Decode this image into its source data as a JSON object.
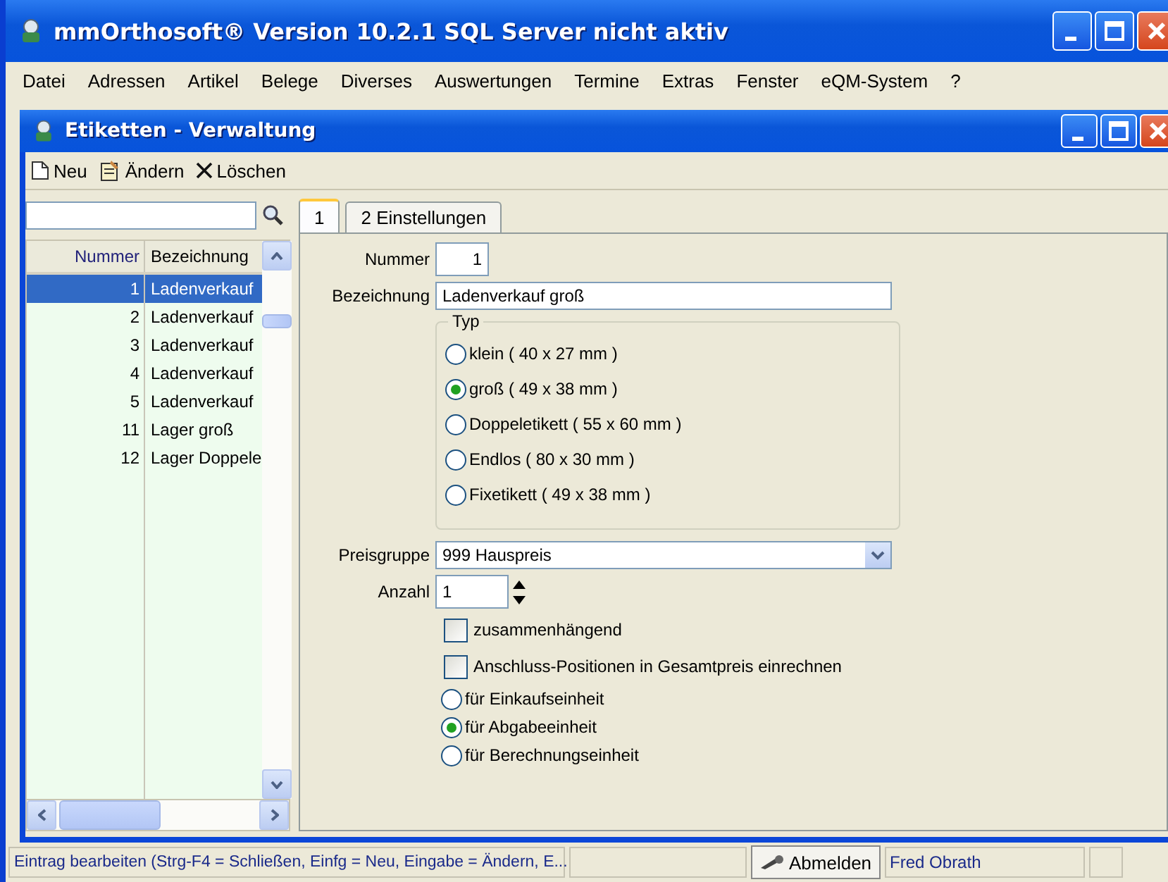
{
  "window": {
    "title": "mmOrthosoft® Version 10.2.1 SQL Server nicht aktiv"
  },
  "menu": [
    "Datei",
    "Adressen",
    "Artikel",
    "Belege",
    "Diverses",
    "Auswertungen",
    "Termine",
    "Extras",
    "Fenster",
    "eQM-System",
    "?"
  ],
  "child_window": {
    "title": "Etiketten - Verwaltung"
  },
  "toolbar": [
    {
      "label": "Neu",
      "kind": "new"
    },
    {
      "label": "Ändern",
      "kind": "edit"
    },
    {
      "label": "Löschen",
      "kind": "delete"
    }
  ],
  "list": {
    "columns": [
      "Nummer",
      "Bezeichnung"
    ],
    "rows": [
      {
        "nummer": "1",
        "bezeichnung": "Ladenverkauf",
        "selected": true
      },
      {
        "nummer": "2",
        "bezeichnung": "Ladenverkauf",
        "selected": false
      },
      {
        "nummer": "3",
        "bezeichnung": "Ladenverkauf",
        "selected": false
      },
      {
        "nummer": "4",
        "bezeichnung": "Ladenverkauf",
        "selected": false
      },
      {
        "nummer": "5",
        "bezeichnung": "Ladenverkauf",
        "selected": false
      },
      {
        "nummer": "11",
        "bezeichnung": "Lager groß",
        "selected": false
      },
      {
        "nummer": "12",
        "bezeichnung": "Lager Doppele",
        "selected": false
      }
    ]
  },
  "tabs": [
    {
      "label": "1",
      "selected": true
    },
    {
      "label": "2 Einstellungen",
      "selected": false
    }
  ],
  "form": {
    "nummer_label": "Nummer",
    "nummer": "1",
    "bezeichnung_label": "Bezeichnung",
    "bezeichnung": "Ladenverkauf groß",
    "typ": {
      "legend": "Typ",
      "options": [
        {
          "label": "klein ( 40 x 27 mm )",
          "selected": false
        },
        {
          "label": "groß ( 49 x 38 mm )",
          "selected": true
        },
        {
          "label": "Doppeletikett ( 55 x 60 mm )",
          "selected": false
        },
        {
          "label": "Endlos ( 80 x 30 mm )",
          "selected": false
        },
        {
          "label": "Fixetikett ( 49 x 38 mm )",
          "selected": false
        }
      ]
    },
    "preisgruppe_label": "Preisgruppe",
    "preisgruppe": "999 Hauspreis",
    "anzahl_label": "Anzahl",
    "anzahl": "1",
    "checkboxes": [
      {
        "label": "zusammenhängend",
        "checked": false
      },
      {
        "label": "Anschluss-Positionen in Gesamtpreis einrechnen",
        "checked": false
      }
    ],
    "einheit": [
      {
        "label": "für Einkaufseinheit",
        "selected": false
      },
      {
        "label": "für Abgabeeinheit",
        "selected": true
      },
      {
        "label": "für Berechnungseinheit",
        "selected": false
      }
    ]
  },
  "status_bar": {
    "message": "Eintrag bearbeiten (Strg-F4 = Schließen, Einfg = Neu, Eingabe = Ändern, E...",
    "button": "Abmelden",
    "user": "Fred Obrath"
  }
}
